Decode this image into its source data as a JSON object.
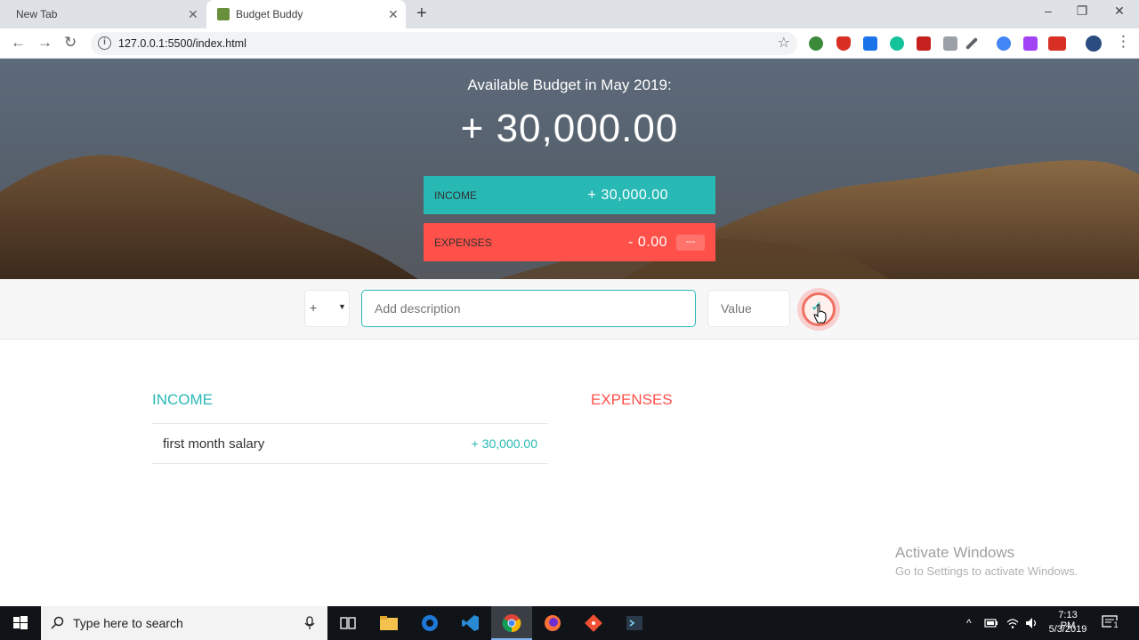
{
  "browser": {
    "tabs": [
      {
        "label": "New Tab"
      },
      {
        "label": "Budget Buddy"
      }
    ],
    "close_glyph": "✕",
    "new_tab_glyph": "+",
    "url": "127.0.0.1:5500/index.html",
    "window_controls": [
      "–",
      "❐",
      "✕"
    ]
  },
  "header": {
    "title": "Available Budget in May 2019:",
    "value": "+ 30,000.00",
    "income": {
      "label": "Income",
      "value": "+ 30,000.00"
    },
    "expenses": {
      "label": "Expenses",
      "value": "- 0.00",
      "percentage": "---"
    }
  },
  "add": {
    "type_value": "+",
    "description_placeholder": "Add description",
    "value_placeholder": "Value"
  },
  "lists": {
    "income_title": "Income",
    "expenses_title": "Expenses",
    "income_items": [
      {
        "description": "first month salary",
        "value": "+ 30,000.00"
      }
    ]
  },
  "watermark": {
    "line1": "Activate Windows",
    "line2": "Go to Settings to activate Windows."
  },
  "taskbar": {
    "search_placeholder": "Type here to search",
    "time": "7:13 PM",
    "date": "5/3/2019",
    "notification_count": "1"
  },
  "colors": {
    "income": "#28b9b5",
    "expense": "#ff5049"
  }
}
